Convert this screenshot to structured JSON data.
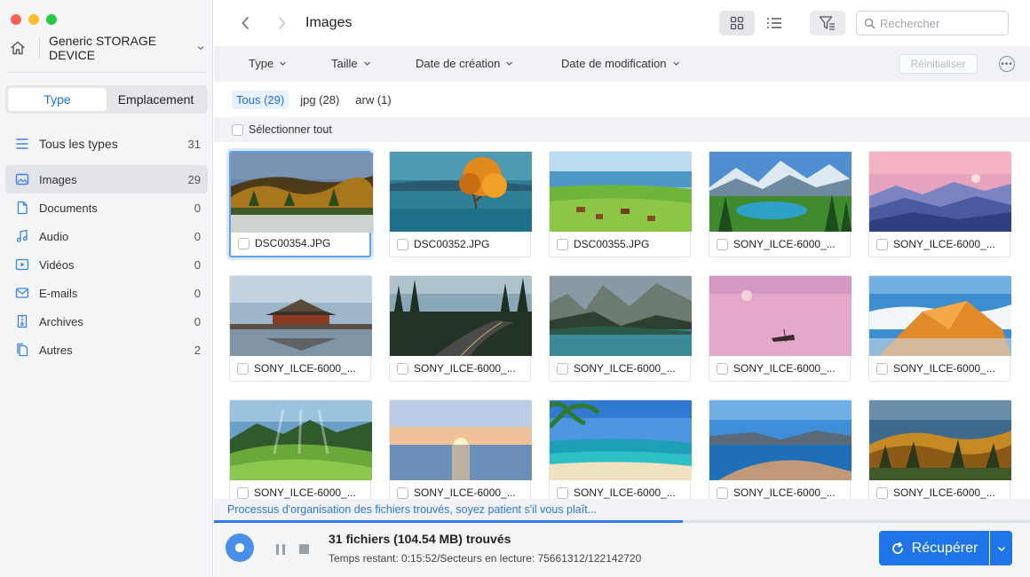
{
  "window": {
    "traffic_colors": [
      "#fe5f57",
      "#febc2e",
      "#28c840"
    ]
  },
  "sidebar": {
    "device_name": "Generic STORAGE DEVICE",
    "tabs": [
      {
        "label": "Type",
        "active": true
      },
      {
        "label": "Emplacement",
        "active": false
      }
    ],
    "categories": [
      {
        "label": "Tous les types",
        "count": "31",
        "icon": "all-types-icon"
      },
      {
        "label": "Images",
        "count": "29",
        "icon": "image-icon",
        "selected": true
      },
      {
        "label": "Documents",
        "count": "0",
        "icon": "document-icon"
      },
      {
        "label": "Audio",
        "count": "0",
        "icon": "music-icon"
      },
      {
        "label": "Vidéos",
        "count": "0",
        "icon": "video-icon"
      },
      {
        "label": "E-mails",
        "count": "0",
        "icon": "mail-icon"
      },
      {
        "label": "Archives",
        "count": "0",
        "icon": "archive-icon"
      },
      {
        "label": "Autres",
        "count": "2",
        "icon": "other-files-icon"
      }
    ]
  },
  "header": {
    "title": "Images",
    "search_placeholder": "Rechercher"
  },
  "filters": {
    "type": "Type",
    "size": "Taille",
    "created": "Date de création",
    "modified": "Date de modification",
    "reset": "Réinitialiser"
  },
  "file_tabs": [
    {
      "label": "Tous (29)",
      "active": true
    },
    {
      "label": "jpg (28)"
    },
    {
      "label": "arw (1)"
    }
  ],
  "select_all": "Sélectionner tout",
  "files": [
    {
      "name": "DSC00354.JPG",
      "selected": true,
      "scene": "autumn-lake"
    },
    {
      "name": "DSC00352.JPG",
      "scene": "tree-lake"
    },
    {
      "name": "DSC00355.JPG",
      "scene": "village-lake"
    },
    {
      "name": "SONY_ILCE-6000_...",
      "scene": "mountain-lake"
    },
    {
      "name": "SONY_ILCE-6000_...",
      "scene": "misty-mountains"
    },
    {
      "name": "SONY_ILCE-6000_...",
      "scene": "pavilion"
    },
    {
      "name": "SONY_ILCE-6000_...",
      "scene": "forest-road"
    },
    {
      "name": "SONY_ILCE-6000_...",
      "scene": "fjord"
    },
    {
      "name": "SONY_ILCE-6000_...",
      "scene": "pink-sea"
    },
    {
      "name": "SONY_ILCE-6000_...",
      "scene": "orange-peak"
    },
    {
      "name": "SONY_ILCE-6000_...",
      "scene": "green-valley"
    },
    {
      "name": "SONY_ILCE-6000_...",
      "scene": "sunset-sea"
    },
    {
      "name": "SONY_ILCE-6000_...",
      "scene": "palm-beach"
    },
    {
      "name": "SONY_ILCE-6000_...",
      "scene": "blue-coast"
    },
    {
      "name": "SONY_ILCE-6000_...",
      "scene": "autumn-forest"
    }
  ],
  "status_message": "Processus d'organisation des fichiers trouvés, soyez patient s'il vous plaît...",
  "progress": 0.575,
  "footer": {
    "found": "31 fichiers (104.54 MB) trouvés",
    "remaining": "Temps restant: 0:15:52/Secteurs en lecture: 75661312/122142720",
    "recover_label": "Récupérer"
  },
  "accent": "#1f74e8"
}
